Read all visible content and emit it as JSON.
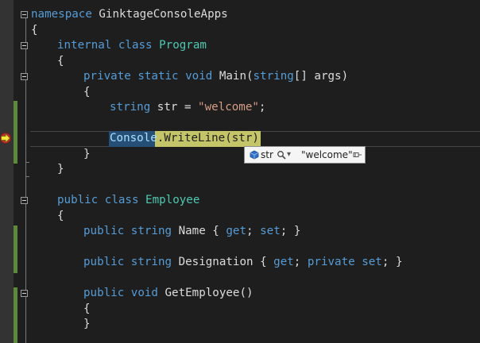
{
  "colors": {
    "background": "#1e1e1e",
    "keyword": "#569cd6",
    "type": "#4ec9b0",
    "string": "#d69d85",
    "text": "#dcdcdc",
    "statement_highlight": "#c4c468",
    "selection": "#264f78",
    "change_bar": "#5c8a3a"
  },
  "code": {
    "l1": {
      "kw": "namespace",
      "name": " GinktageConsoleApps"
    },
    "l2": {
      "text": "{"
    },
    "l3": {
      "kw": "internal class",
      "type": "Program"
    },
    "l4": {
      "text": "{"
    },
    "l5": {
      "kw": "private static void",
      "name": " Main(",
      "kw2": "string",
      "rest": "[] args)"
    },
    "l6": {
      "text": "{"
    },
    "l7": {
      "kw": "string",
      "name": " str = ",
      "str": "\"welcome\"",
      "end": ";"
    },
    "l8": {
      "type": "Console",
      "rest": ".WriteLine(str);"
    },
    "l9": {
      "text": "}"
    },
    "l10": {
      "text": "}"
    },
    "l11": {
      "kw": "public class",
      "type": "Employee"
    },
    "l12": {
      "text": "{"
    },
    "l13": {
      "kw": "public",
      "kw2": "string",
      "name": " Name { ",
      "kw3": "get",
      "mid": "; ",
      "kw4": "set",
      "end": "; }"
    },
    "l14": {
      "kw": "public",
      "kw2": "string",
      "name": " Designation { ",
      "kw3": "get",
      "mid": "; ",
      "kw4": "private set",
      "end": "; }"
    },
    "l15": {
      "kw": "public void",
      "name": " GetEmployee()"
    },
    "l16": {
      "text": "{"
    },
    "l17": {
      "text": "}"
    }
  },
  "datatip": {
    "name": "str",
    "value": "\"welcome\"",
    "icons": [
      "variable-icon",
      "magnifier-icon",
      "dropdown-arrow-icon",
      "pin-icon"
    ]
  },
  "icons": {
    "breakpoint": "current-statement-arrow-icon",
    "fold": "collapse-minus-icon"
  }
}
